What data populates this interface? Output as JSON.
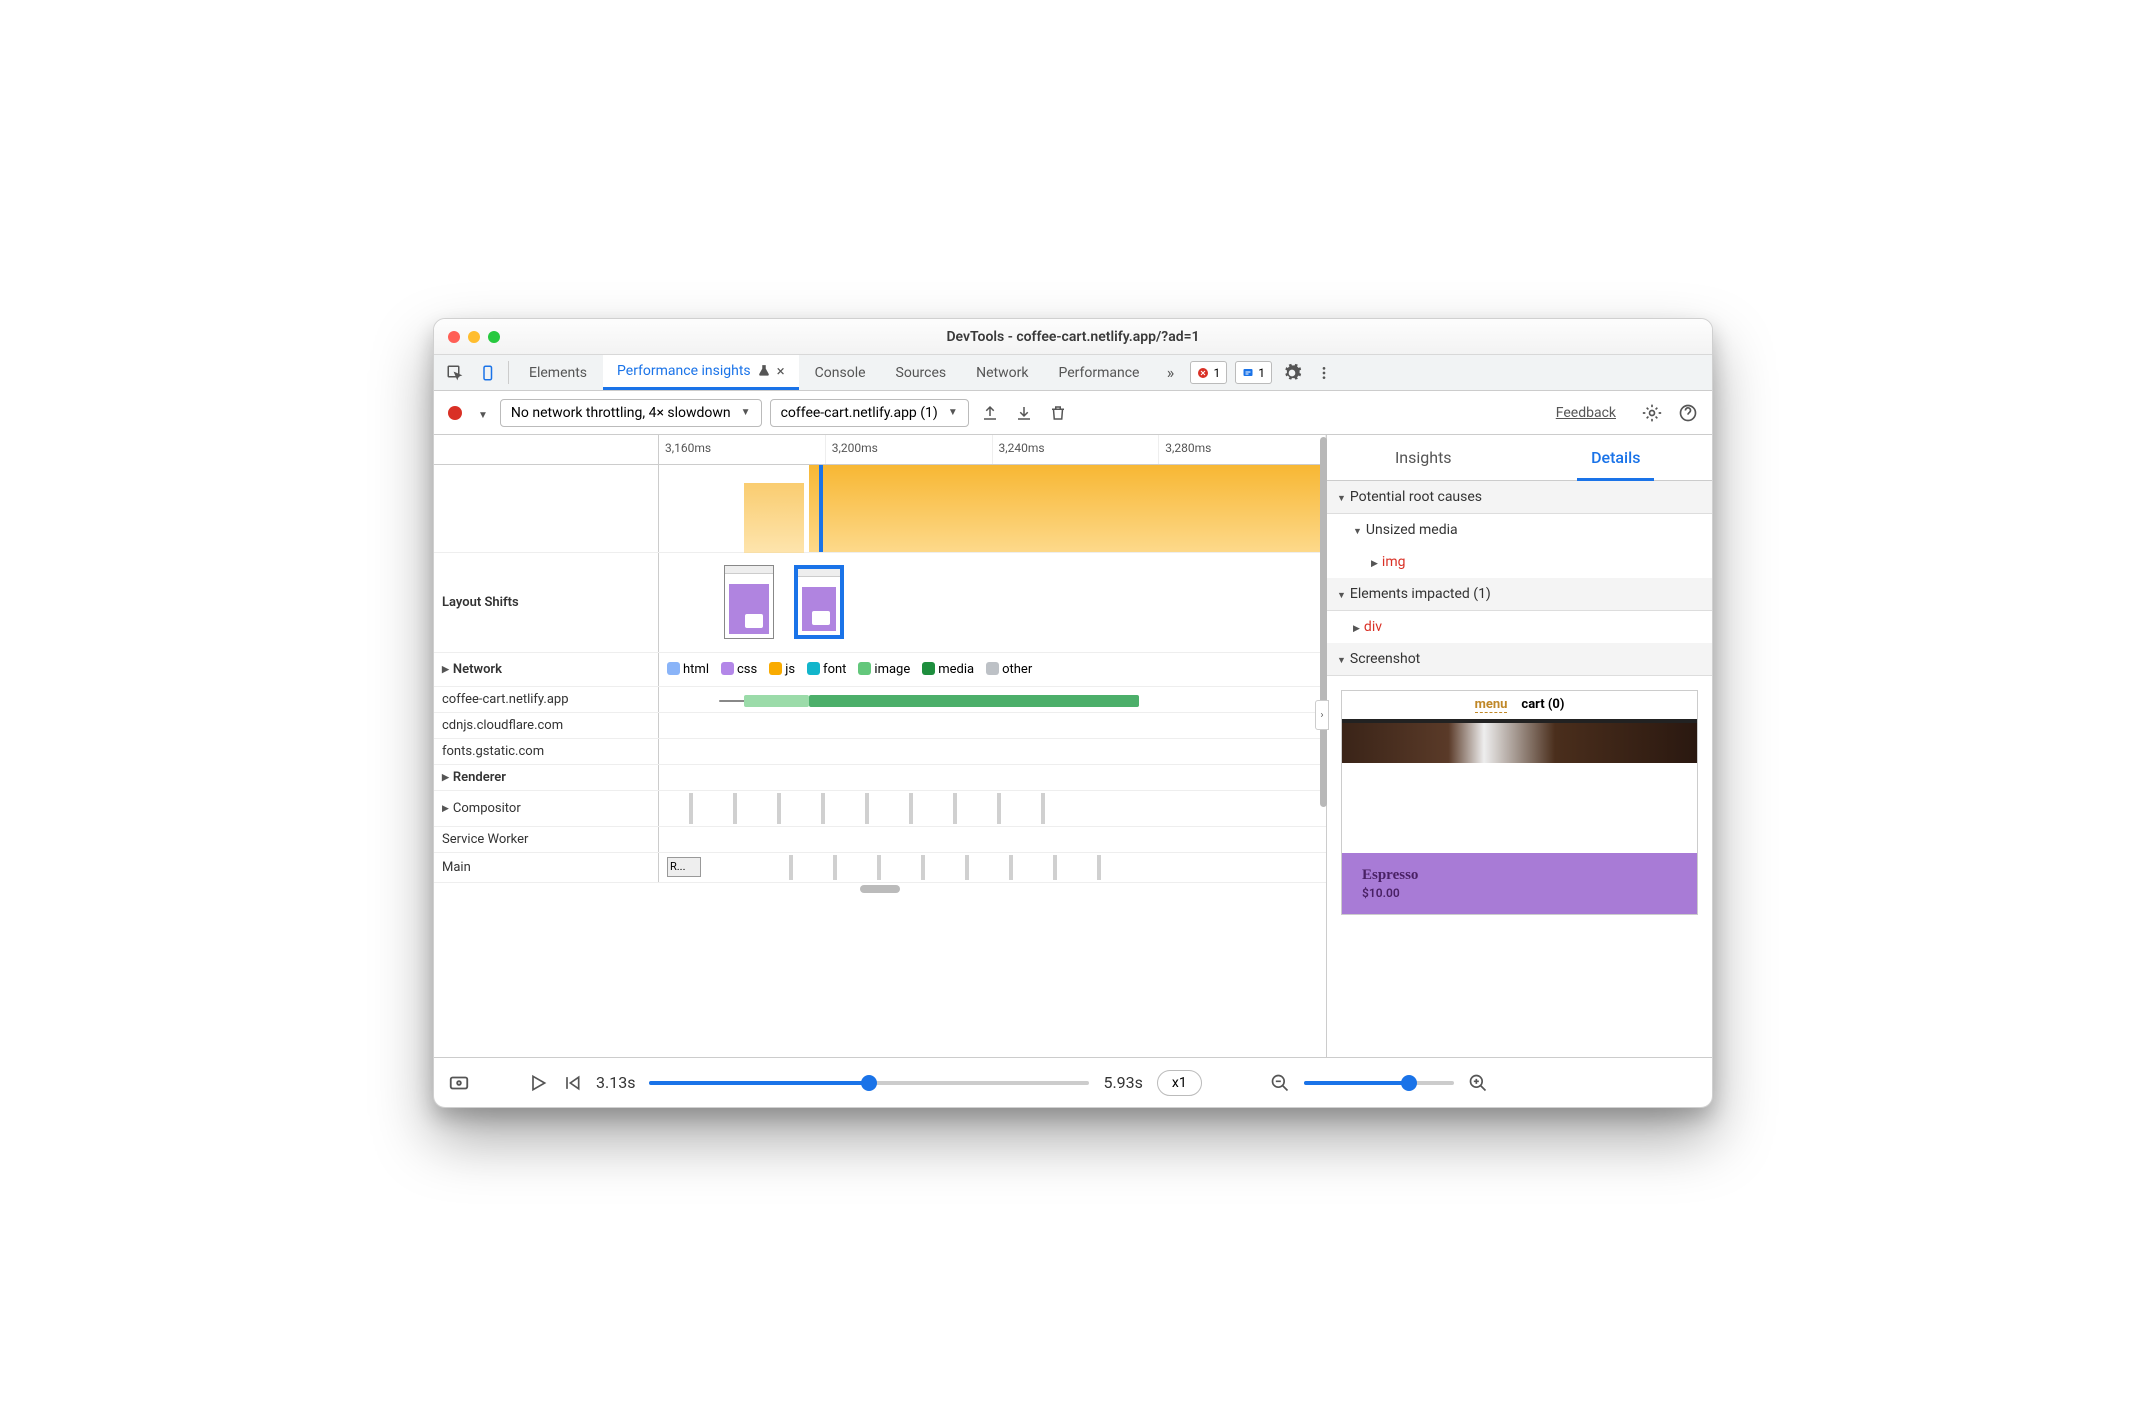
{
  "window": {
    "title": "DevTools - coffee-cart.netlify.app/?ad=1"
  },
  "tabs": {
    "items": [
      "Elements",
      "Performance insights",
      "Console",
      "Sources",
      "Network",
      "Performance"
    ],
    "active": "Performance insights",
    "errBadge": "1",
    "msgBadge": "1"
  },
  "toolbar": {
    "throttle": "No network throttling, 4× slowdown",
    "site": "coffee-cart.netlify.app (1)",
    "feedback": "Feedback"
  },
  "ruler": [
    "3,160ms",
    "3,200ms",
    "3,240ms",
    "3,280ms"
  ],
  "rows": {
    "layoutShifts": "Layout Shifts",
    "network": "Network",
    "networkHosts": [
      "coffee-cart.netlify.app",
      "cdnjs.cloudflare.com",
      "fonts.gstatic.com"
    ],
    "renderer": "Renderer",
    "rendererRows": [
      "Compositor",
      "Service Worker",
      "Main"
    ],
    "mainBlock": "R..."
  },
  "legend": [
    {
      "label": "html",
      "color": "#8ab4f8"
    },
    {
      "label": "css",
      "color": "#b387e8"
    },
    {
      "label": "js",
      "color": "#f9ab00"
    },
    {
      "label": "font",
      "color": "#12b5cb"
    },
    {
      "label": "image",
      "color": "#63c77b"
    },
    {
      "label": "media",
      "color": "#1e8e3e"
    },
    {
      "label": "other",
      "color": "#bdc1c6"
    }
  ],
  "details": {
    "tabs": [
      "Insights",
      "Details"
    ],
    "active": "Details",
    "sections": {
      "rootCauses": "Potential root causes",
      "unsized": "Unsized media",
      "img": "img",
      "impacted": "Elements impacted (1)",
      "div": "div",
      "screenshot": "Screenshot"
    },
    "ss": {
      "menu": "menu",
      "cart": "cart (0)",
      "product": "Espresso",
      "price": "$10.00"
    }
  },
  "footer": {
    "start": "3.13s",
    "end": "5.93s",
    "speed": "x1"
  }
}
